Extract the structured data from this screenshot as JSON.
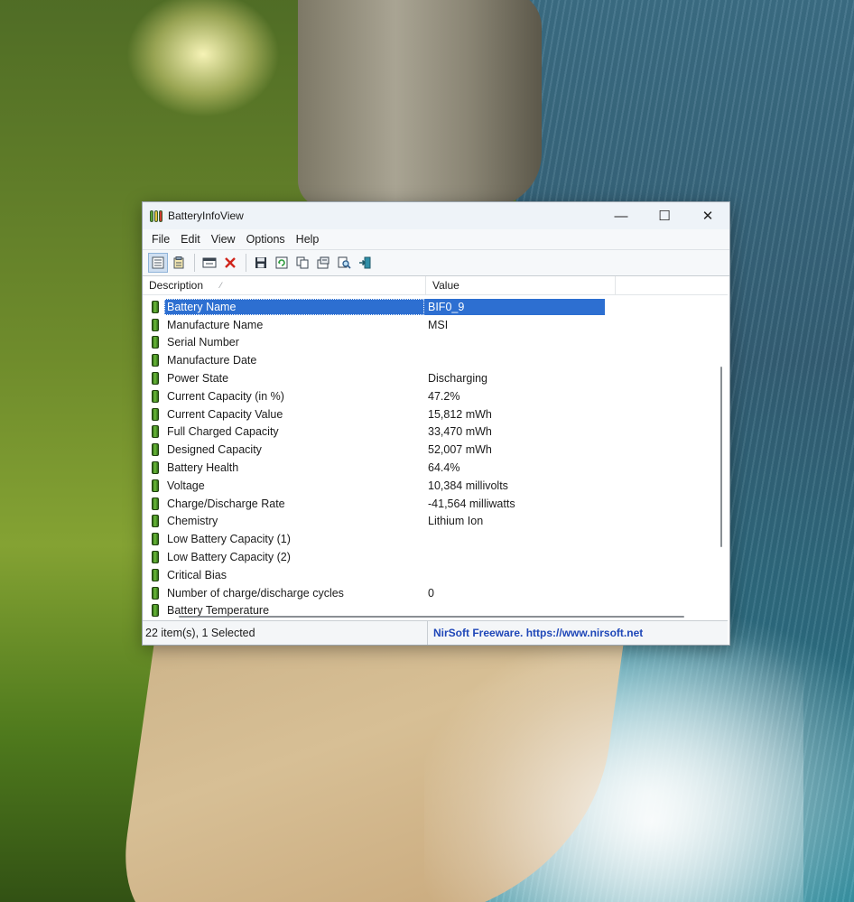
{
  "window": {
    "title": "BatteryInfoView",
    "minimize_glyph": "—",
    "maximize_glyph": "☐",
    "close_glyph": "✕"
  },
  "menu": [
    "File",
    "Edit",
    "View",
    "Options",
    "Help"
  ],
  "toolbar_icons": [
    "html-report-all-icon",
    "html-report-selected-icon",
    "properties-window-icon",
    "delete-icon",
    "save-icon",
    "refresh-icon",
    "copy-icon",
    "properties-icon",
    "find-icon",
    "exit-icon"
  ],
  "columns": {
    "description": "Description",
    "value": "Value"
  },
  "rows": [
    {
      "description": "Battery Name",
      "value": "BIF0_9",
      "selected": true
    },
    {
      "description": "Manufacture Name",
      "value": "MSI"
    },
    {
      "description": "Serial Number",
      "value": ""
    },
    {
      "description": "Manufacture Date",
      "value": ""
    },
    {
      "description": "Power State",
      "value": "Discharging"
    },
    {
      "description": "Current Capacity (in %)",
      "value": "47.2%"
    },
    {
      "description": "Current Capacity Value",
      "value": "15,812 mWh"
    },
    {
      "description": "Full Charged Capacity",
      "value": "33,470 mWh"
    },
    {
      "description": "Designed Capacity",
      "value": "52,007 mWh"
    },
    {
      "description": "Battery Health",
      "value": "64.4%"
    },
    {
      "description": "Voltage",
      "value": "10,384 millivolts"
    },
    {
      "description": "Charge/Discharge Rate",
      "value": "-41,564 milliwatts"
    },
    {
      "description": "Chemistry",
      "value": "Lithium Ion"
    },
    {
      "description": "Low Battery Capacity (1)",
      "value": ""
    },
    {
      "description": "Low Battery Capacity (2)",
      "value": ""
    },
    {
      "description": "Critical Bias",
      "value": ""
    },
    {
      "description": "Number of charge/discharge cycles",
      "value": "0"
    },
    {
      "description": "Battery Temperature",
      "value": ""
    }
  ],
  "status": {
    "count": "22 item(s), 1 Selected",
    "link": "NirSoft Freeware. https://www.nirsoft.net"
  },
  "colors": {
    "selection": "#2d6fd1",
    "link": "#1f47b8",
    "battery_icon": "#5aa03a"
  }
}
